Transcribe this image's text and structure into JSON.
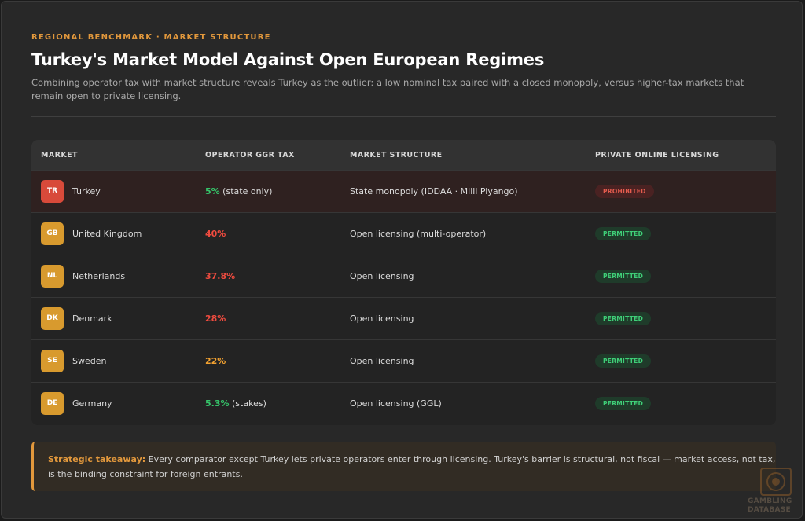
{
  "header": {
    "eyebrow": "REGIONAL BENCHMARK · MARKET STRUCTURE",
    "title": "Turkey's Market Model Against Open European Regimes",
    "subtitle": "Combining operator tax with market structure reveals Turkey as the outlier: a low nominal tax paired with a closed monopoly, versus higher-tax markets that remain open to private licensing."
  },
  "table": {
    "columns": [
      "MARKET",
      "OPERATOR GGR TAX",
      "MARKET STRUCTURE",
      "PRIVATE ONLINE LICENSING"
    ],
    "rows": [
      {
        "code": "TR",
        "market": "Turkey",
        "tax": "5%",
        "tax_note": " (state only)",
        "structure": "State monopoly (IDDAA · Milli Piyango)",
        "licensing": "PROHIBITED"
      },
      {
        "code": "GB",
        "market": "United Kingdom",
        "tax": "40%",
        "tax_note": "",
        "structure": "Open licensing (multi-operator)",
        "licensing": "PERMITTED"
      },
      {
        "code": "NL",
        "market": "Netherlands",
        "tax": "37.8%",
        "tax_note": "",
        "structure": "Open licensing",
        "licensing": "PERMITTED"
      },
      {
        "code": "DK",
        "market": "Denmark",
        "tax": "28%",
        "tax_note": "",
        "structure": "Open licensing",
        "licensing": "PERMITTED"
      },
      {
        "code": "SE",
        "market": "Sweden",
        "tax": "22%",
        "tax_note": "",
        "structure": "Open licensing",
        "licensing": "PERMITTED"
      },
      {
        "code": "DE",
        "market": "Germany",
        "tax": "5.3%",
        "tax_note": " (stakes)",
        "structure": "Open licensing (GGL)",
        "licensing": "PERMITTED"
      }
    ]
  },
  "takeaway": {
    "lead": "Strategic takeaway:",
    "text": " Every comparator except Turkey lets private operators enter through licensing. Turkey's barrier is structural, not fiscal — market access, not tax, is the binding constraint for foreign entrants."
  },
  "brand": {
    "line1": "GAMBLING",
    "line2": "DATABASE",
    "icon": "chip-logo-icon"
  },
  "colors": {
    "accent": "#e2983c",
    "badge_red": "#d84a3a",
    "badge_amber": "#d89a2e",
    "tax_green": "#35c46a",
    "tax_red": "#ef4b3f",
    "tax_orange": "#f0a030",
    "pill_red_bg": "#4a2222",
    "pill_red_fg": "#e65c4e",
    "pill_green_bg": "#1f3b2a",
    "pill_green_fg": "#3fcf78"
  }
}
